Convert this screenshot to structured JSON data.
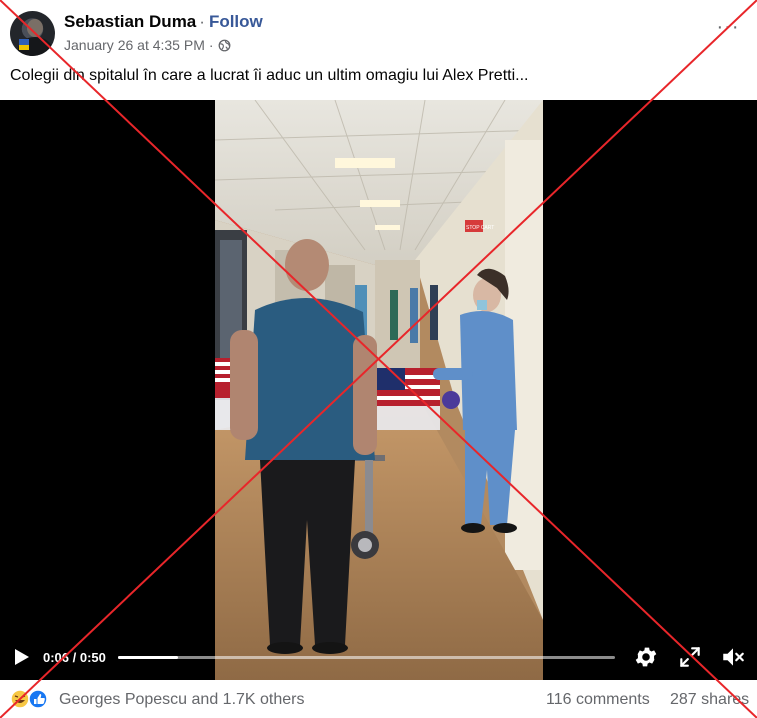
{
  "post": {
    "author": "Sebastian Duma",
    "follow_label": "Follow",
    "separator": "·",
    "timestamp": "January 26 at 4:35 PM",
    "audience_icon": "globe-icon",
    "more_label": "···",
    "caption": "Colegii din spitalul în care a lucrat îi aduc un ultim omagiu lui Alex Pretti..."
  },
  "video": {
    "current_time": "0:06",
    "duration": "0:50",
    "time_display": "0:06 / 0:50",
    "progress_fraction": 0.12,
    "scene_sign": "STOP CART",
    "icons": [
      "play-icon",
      "settings-gear-icon",
      "fullscreen-icon",
      "volume-muted-icon"
    ]
  },
  "footer": {
    "reactions_label": "Georges Popescu and 1.7K others",
    "reaction_icons": [
      "haha-reaction-icon",
      "like-reaction-icon"
    ],
    "comments": "116 comments",
    "shares": "287 shares"
  },
  "overlay": {
    "type": "red-cross",
    "color": "#e8262a"
  }
}
